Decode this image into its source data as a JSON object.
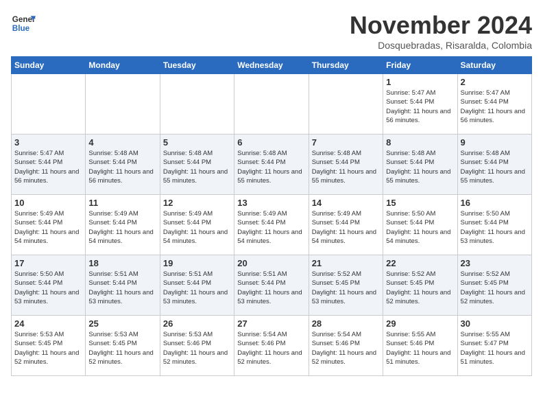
{
  "header": {
    "logo_general": "General",
    "logo_blue": "Blue",
    "month_title": "November 2024",
    "subtitle": "Dosquebradas, Risaralda, Colombia"
  },
  "days_of_week": [
    "Sunday",
    "Monday",
    "Tuesday",
    "Wednesday",
    "Thursday",
    "Friday",
    "Saturday"
  ],
  "weeks": [
    [
      {
        "day": "",
        "info": ""
      },
      {
        "day": "",
        "info": ""
      },
      {
        "day": "",
        "info": ""
      },
      {
        "day": "",
        "info": ""
      },
      {
        "day": "",
        "info": ""
      },
      {
        "day": "1",
        "info": "Sunrise: 5:47 AM\nSunset: 5:44 PM\nDaylight: 11 hours and 56 minutes."
      },
      {
        "day": "2",
        "info": "Sunrise: 5:47 AM\nSunset: 5:44 PM\nDaylight: 11 hours and 56 minutes."
      }
    ],
    [
      {
        "day": "3",
        "info": "Sunrise: 5:47 AM\nSunset: 5:44 PM\nDaylight: 11 hours and 56 minutes."
      },
      {
        "day": "4",
        "info": "Sunrise: 5:48 AM\nSunset: 5:44 PM\nDaylight: 11 hours and 56 minutes."
      },
      {
        "day": "5",
        "info": "Sunrise: 5:48 AM\nSunset: 5:44 PM\nDaylight: 11 hours and 55 minutes."
      },
      {
        "day": "6",
        "info": "Sunrise: 5:48 AM\nSunset: 5:44 PM\nDaylight: 11 hours and 55 minutes."
      },
      {
        "day": "7",
        "info": "Sunrise: 5:48 AM\nSunset: 5:44 PM\nDaylight: 11 hours and 55 minutes."
      },
      {
        "day": "8",
        "info": "Sunrise: 5:48 AM\nSunset: 5:44 PM\nDaylight: 11 hours and 55 minutes."
      },
      {
        "day": "9",
        "info": "Sunrise: 5:48 AM\nSunset: 5:44 PM\nDaylight: 11 hours and 55 minutes."
      }
    ],
    [
      {
        "day": "10",
        "info": "Sunrise: 5:49 AM\nSunset: 5:44 PM\nDaylight: 11 hours and 54 minutes."
      },
      {
        "day": "11",
        "info": "Sunrise: 5:49 AM\nSunset: 5:44 PM\nDaylight: 11 hours and 54 minutes."
      },
      {
        "day": "12",
        "info": "Sunrise: 5:49 AM\nSunset: 5:44 PM\nDaylight: 11 hours and 54 minutes."
      },
      {
        "day": "13",
        "info": "Sunrise: 5:49 AM\nSunset: 5:44 PM\nDaylight: 11 hours and 54 minutes."
      },
      {
        "day": "14",
        "info": "Sunrise: 5:49 AM\nSunset: 5:44 PM\nDaylight: 11 hours and 54 minutes."
      },
      {
        "day": "15",
        "info": "Sunrise: 5:50 AM\nSunset: 5:44 PM\nDaylight: 11 hours and 54 minutes."
      },
      {
        "day": "16",
        "info": "Sunrise: 5:50 AM\nSunset: 5:44 PM\nDaylight: 11 hours and 53 minutes."
      }
    ],
    [
      {
        "day": "17",
        "info": "Sunrise: 5:50 AM\nSunset: 5:44 PM\nDaylight: 11 hours and 53 minutes."
      },
      {
        "day": "18",
        "info": "Sunrise: 5:51 AM\nSunset: 5:44 PM\nDaylight: 11 hours and 53 minutes."
      },
      {
        "day": "19",
        "info": "Sunrise: 5:51 AM\nSunset: 5:44 PM\nDaylight: 11 hours and 53 minutes."
      },
      {
        "day": "20",
        "info": "Sunrise: 5:51 AM\nSunset: 5:44 PM\nDaylight: 11 hours and 53 minutes."
      },
      {
        "day": "21",
        "info": "Sunrise: 5:52 AM\nSunset: 5:45 PM\nDaylight: 11 hours and 53 minutes."
      },
      {
        "day": "22",
        "info": "Sunrise: 5:52 AM\nSunset: 5:45 PM\nDaylight: 11 hours and 52 minutes."
      },
      {
        "day": "23",
        "info": "Sunrise: 5:52 AM\nSunset: 5:45 PM\nDaylight: 11 hours and 52 minutes."
      }
    ],
    [
      {
        "day": "24",
        "info": "Sunrise: 5:53 AM\nSunset: 5:45 PM\nDaylight: 11 hours and 52 minutes."
      },
      {
        "day": "25",
        "info": "Sunrise: 5:53 AM\nSunset: 5:45 PM\nDaylight: 11 hours and 52 minutes."
      },
      {
        "day": "26",
        "info": "Sunrise: 5:53 AM\nSunset: 5:46 PM\nDaylight: 11 hours and 52 minutes."
      },
      {
        "day": "27",
        "info": "Sunrise: 5:54 AM\nSunset: 5:46 PM\nDaylight: 11 hours and 52 minutes."
      },
      {
        "day": "28",
        "info": "Sunrise: 5:54 AM\nSunset: 5:46 PM\nDaylight: 11 hours and 52 minutes."
      },
      {
        "day": "29",
        "info": "Sunrise: 5:55 AM\nSunset: 5:46 PM\nDaylight: 11 hours and 51 minutes."
      },
      {
        "day": "30",
        "info": "Sunrise: 5:55 AM\nSunset: 5:47 PM\nDaylight: 11 hours and 51 minutes."
      }
    ]
  ]
}
